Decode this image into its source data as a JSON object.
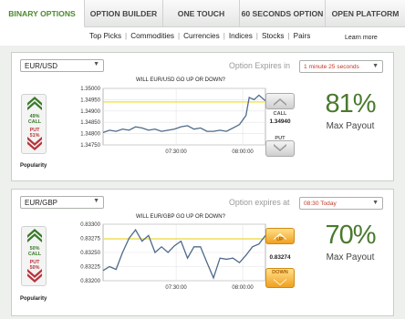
{
  "tabs": [
    {
      "label": "BINARY OPTIONS",
      "active": true
    },
    {
      "label": "OPTION BUILDER"
    },
    {
      "label": "ONE TOUCH"
    },
    {
      "label": "60 SECONDS OPTION"
    },
    {
      "label": "OPEN PLATFORM"
    }
  ],
  "subnav": {
    "links": [
      "Top Picks",
      "Commodities",
      "Currencies",
      "Indices",
      "Stocks",
      "Pairs"
    ],
    "more": "Learn more"
  },
  "panels": [
    {
      "pair": "EUR/USD",
      "expires_label": "Option Expires in",
      "expires_value": "1 minute 25 seconds",
      "question": "WILL EUR/USD GO UP OR DOWN?",
      "call_pct": "49%",
      "call_label": "CALL",
      "put_label": "PUT",
      "put_pct": "51%",
      "popularity": "Popularity",
      "call_button": "CALL",
      "rate": "1.34940",
      "put_button": "PUT",
      "payout": "81%",
      "payout_label": "Max Payout"
    },
    {
      "pair": "EUR/GBP",
      "expires_label": "Option expires at",
      "expires_value": "08:30 Today",
      "question": "WILL EUR/GBP GO UP OR DOWN?",
      "call_pct": "50%",
      "call_label": "CALL",
      "put_label": "PUT",
      "put_pct": "50%",
      "popularity": "Popularity",
      "call_button": "UP",
      "rate": "0.83274",
      "put_button": "DOWN",
      "payout": "70%",
      "payout_label": "Max Payout"
    }
  ],
  "chart_data": [
    {
      "type": "line",
      "title": "WILL EUR/USD GO UP OR DOWN?",
      "y_ticks": [
        "1.35000",
        "1.34950",
        "1.34900",
        "1.34850",
        "1.34800",
        "1.34750"
      ],
      "x_ticks": [
        "07:30:00",
        "08:00:00"
      ],
      "ylim": [
        1.3475,
        1.35
      ],
      "strike": 1.3494,
      "x": [
        0,
        0.04,
        0.08,
        0.12,
        0.16,
        0.2,
        0.24,
        0.28,
        0.32,
        0.36,
        0.4,
        0.44,
        0.48,
        0.52,
        0.56,
        0.6,
        0.64,
        0.68,
        0.72,
        0.76,
        0.8,
        0.84,
        0.88,
        0.9,
        0.93,
        0.96,
        1.0
      ],
      "y": [
        1.34805,
        1.34815,
        1.3481,
        1.3482,
        1.34815,
        1.3483,
        1.34825,
        1.34815,
        1.3482,
        1.3481,
        1.34815,
        1.3482,
        1.3483,
        1.34835,
        1.3482,
        1.34825,
        1.3481,
        1.3481,
        1.34815,
        1.3481,
        1.34825,
        1.3484,
        1.3488,
        1.3496,
        1.3495,
        1.3497,
        1.34945
      ],
      "colors": {
        "line": "#4d6a8a",
        "strike": "#f2e02a"
      }
    },
    {
      "type": "line",
      "title": "WILL EUR/GBP GO UP OR DOWN?",
      "y_ticks": [
        "0.83300",
        "0.83275",
        "0.83250",
        "0.83225",
        "0.83200"
      ],
      "x_ticks": [
        "07:30:00",
        "08:00:00"
      ],
      "ylim": [
        0.832,
        0.833
      ],
      "strike": 0.83274,
      "x": [
        0,
        0.04,
        0.08,
        0.12,
        0.16,
        0.2,
        0.24,
        0.28,
        0.32,
        0.36,
        0.4,
        0.44,
        0.48,
        0.52,
        0.56,
        0.6,
        0.64,
        0.68,
        0.72,
        0.76,
        0.8,
        0.84,
        0.88,
        0.92,
        0.96,
        1.0
      ],
      "y": [
        0.83218,
        0.83225,
        0.8322,
        0.8325,
        0.83275,
        0.8329,
        0.8327,
        0.8328,
        0.8325,
        0.8326,
        0.8325,
        0.83262,
        0.8327,
        0.8324,
        0.8326,
        0.8326,
        0.83232,
        0.83205,
        0.8324,
        0.83238,
        0.8324,
        0.83232,
        0.83245,
        0.8326,
        0.83265,
        0.8328
      ],
      "colors": {
        "line": "#4d6a8a",
        "strike": "#f2e02a"
      }
    }
  ],
  "colors": {
    "accent": "#4a8a2a",
    "payout": "#4a7a2e",
    "call": "#3a7a2a",
    "put": "#b8343a",
    "expires": "#c0392b"
  }
}
